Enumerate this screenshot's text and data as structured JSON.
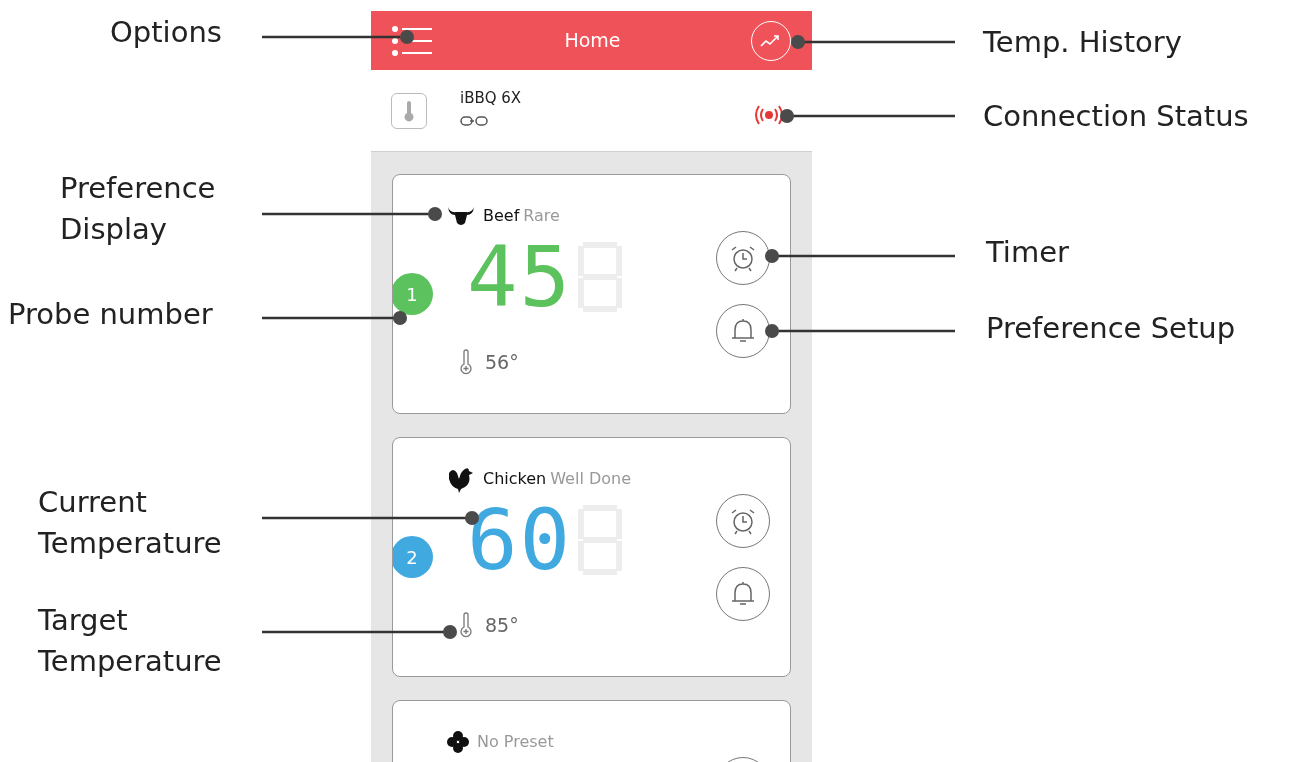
{
  "header": {
    "title": "Home"
  },
  "device": {
    "name": "iBBQ 6X"
  },
  "probes": [
    {
      "kind": "beef",
      "number": "1",
      "color": "#5cc25d",
      "meat": "Beef",
      "doneness": "Rare",
      "reading": "45",
      "target": "56°"
    },
    {
      "kind": "chicken",
      "number": "2",
      "color": "#3fa9e0",
      "meat": "Chicken",
      "doneness": "Well Done",
      "reading": "60",
      "target": "85°"
    },
    {
      "kind": "none",
      "doneness": "No Preset"
    }
  ],
  "callouts": {
    "options": "Options",
    "preference_display": "Preference Display",
    "probe_number": "Probe number",
    "current_temperature": "Current Temperature",
    "target_temperature": "Target Temperature",
    "temp_history": "Temp. History",
    "connection_status": "Connection Status",
    "timer": "Timer",
    "preference_setup": "Preference Setup"
  }
}
